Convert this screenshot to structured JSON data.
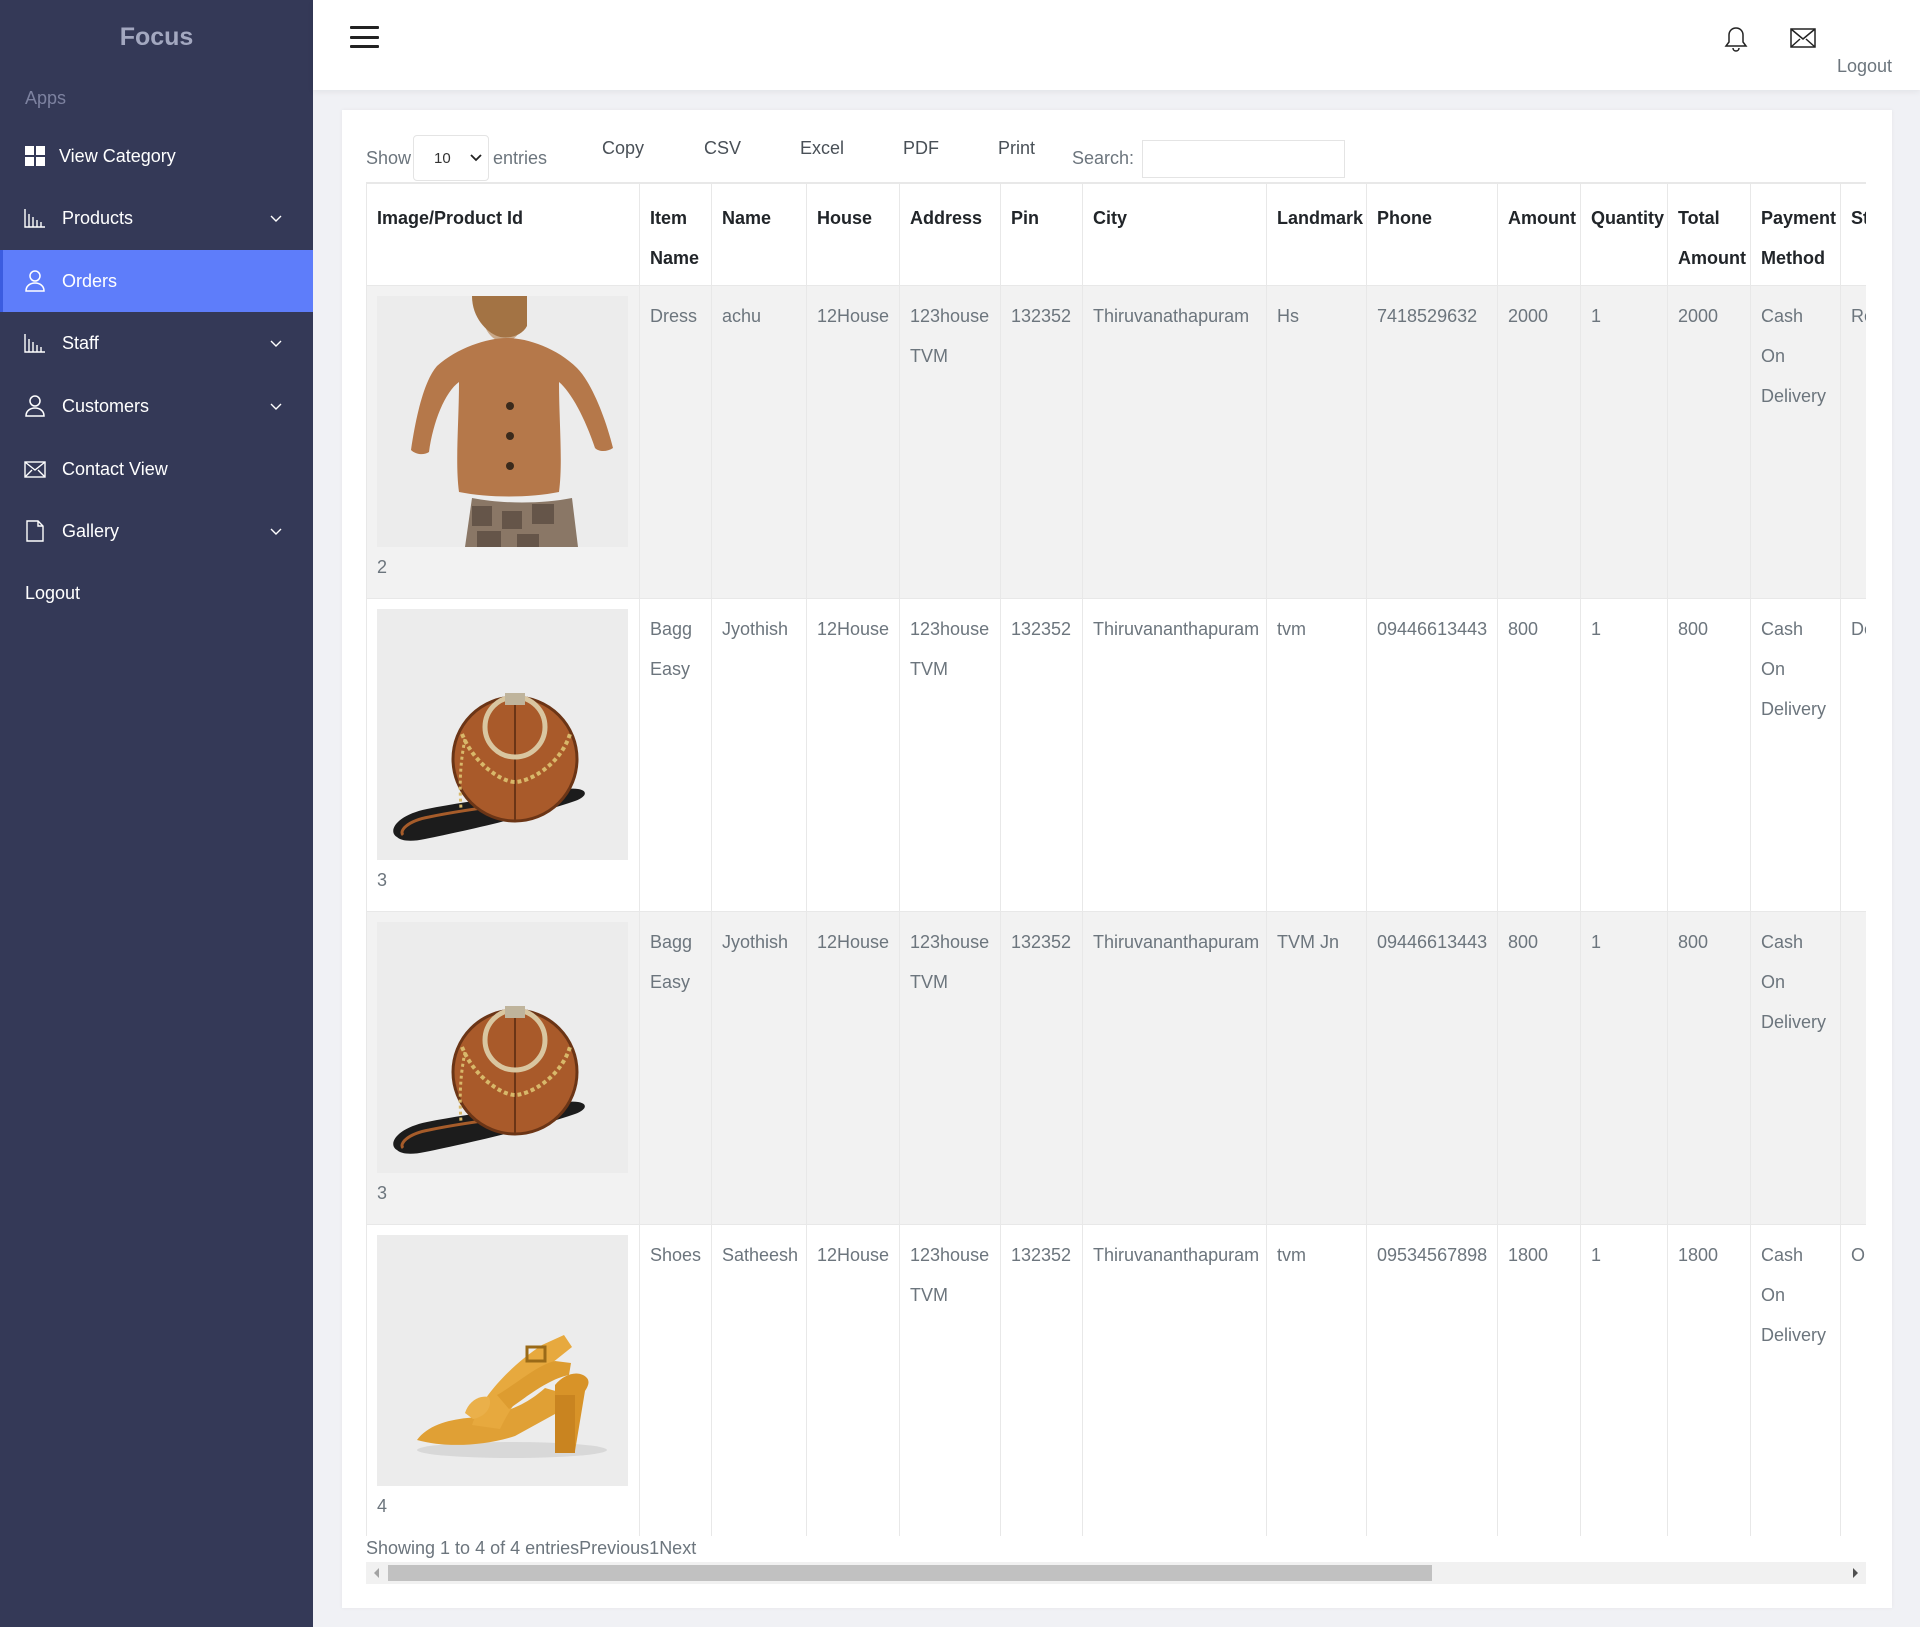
{
  "sidebar": {
    "brand": "Focus",
    "section": "Apps",
    "items": [
      {
        "label": "View Category"
      },
      {
        "label": "Products"
      },
      {
        "label": "Orders"
      },
      {
        "label": "Staff"
      },
      {
        "label": "Customers"
      },
      {
        "label": "Contact View"
      },
      {
        "label": "Gallery"
      },
      {
        "label": "Logout"
      }
    ]
  },
  "header": {
    "logout": "Logout"
  },
  "controls": {
    "show": "Show",
    "entries_value": "10",
    "entries": "entries",
    "buttons": [
      "Copy",
      "CSV",
      "Excel",
      "PDF",
      "Print"
    ],
    "search_label": "Search:"
  },
  "table": {
    "headers": [
      "Image/Product Id",
      "Item Name",
      "Name",
      "House",
      "Address",
      "Pin",
      "City",
      "Landmark",
      "Phone",
      "Amount",
      "Quantity",
      "Total Amount",
      "Payment Method",
      "St"
    ],
    "rows": [
      {
        "id": "2",
        "item": "Dress",
        "name": "achu",
        "house": "12House",
        "address": "123house TVM",
        "pin": "132352",
        "city": "Thiruvanathapuram",
        "landmark": "Hs",
        "phone": "7418529632",
        "amount": "2000",
        "qty": "1",
        "total": "2000",
        "payment": "Cash On Delivery",
        "status": "Re"
      },
      {
        "id": "3",
        "item": "Bagg Easy",
        "name": "Jyothish",
        "house": "12House",
        "address": "123house TVM",
        "pin": "132352",
        "city": "Thiruvananthapuram",
        "landmark": "tvm",
        "phone": "09446613443",
        "amount": "800",
        "qty": "1",
        "total": "800",
        "payment": "Cash On Delivery",
        "status": "De"
      },
      {
        "id": "3",
        "item": "Bagg Easy",
        "name": "Jyothish",
        "house": "12House",
        "address": "123house TVM",
        "pin": "132352",
        "city": "Thiruvananthapuram",
        "landmark": "TVM Jn",
        "phone": "09446613443",
        "amount": "800",
        "qty": "1",
        "total": "800",
        "payment": "Cash On Delivery",
        "status": ""
      },
      {
        "id": "4",
        "item": "Shoes",
        "name": "Satheesh",
        "house": "12House",
        "address": "123house TVM",
        "pin": "132352",
        "city": "Thiruvananthapuram",
        "landmark": "tvm",
        "phone": "09534567898",
        "amount": "1800",
        "qty": "1",
        "total": "1800",
        "payment": "Cash On Delivery",
        "status": "O ac"
      }
    ]
  },
  "footer": {
    "info": "Showing 1 to 4 of 4 entries",
    "previous": "Previous",
    "page": "1",
    "next": "Next"
  }
}
